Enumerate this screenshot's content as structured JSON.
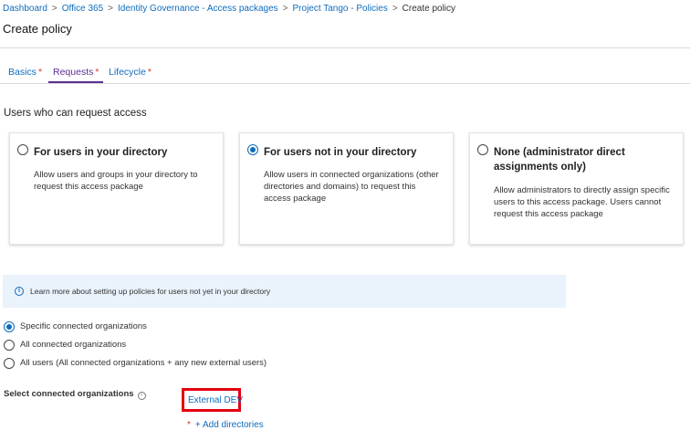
{
  "breadcrumb": {
    "items": [
      "Dashboard",
      "Office 365",
      "Identity Governance - Access packages",
      "Project Tango - Policies"
    ],
    "current": "Create policy",
    "separator": ">"
  },
  "page": {
    "title": "Create policy"
  },
  "tabs": [
    {
      "label": "Basics",
      "required": "*",
      "active": false
    },
    {
      "label": "Requests",
      "required": "*",
      "active": true
    },
    {
      "label": "Lifecycle",
      "required": "*",
      "active": false
    }
  ],
  "requests": {
    "heading": "Users who can request access",
    "cards": [
      {
        "title": "For users in your directory",
        "description": "Allow users and groups in your directory to request this access package",
        "selected": false
      },
      {
        "title": "For users not in your directory",
        "description": "Allow users in connected organizations (other directories and domains) to request this access package",
        "selected": true
      },
      {
        "title": "None (administrator direct assignments only)",
        "description": "Allow administrators to directly assign specific users to this access package. Users cannot request this access package",
        "selected": false
      }
    ],
    "info": {
      "icon": "info-icon",
      "text": "Learn more about setting up policies for users not yet in your directory"
    },
    "scope_options": [
      {
        "label": "Specific connected organizations",
        "selected": true
      },
      {
        "label": "All connected organizations",
        "selected": false
      },
      {
        "label": "All users (All connected organizations + any new external users)",
        "selected": false
      }
    ],
    "select_orgs": {
      "label": "Select connected organizations",
      "selected_org": "External DEV",
      "add_required": "*",
      "add_link": "+ Add directories"
    }
  },
  "colors": {
    "link": "#0f6cbd",
    "active_tab": "#5c2d91",
    "required": "#d13438",
    "highlight": "#e3000f",
    "info_bg": "#eaf2fb"
  }
}
